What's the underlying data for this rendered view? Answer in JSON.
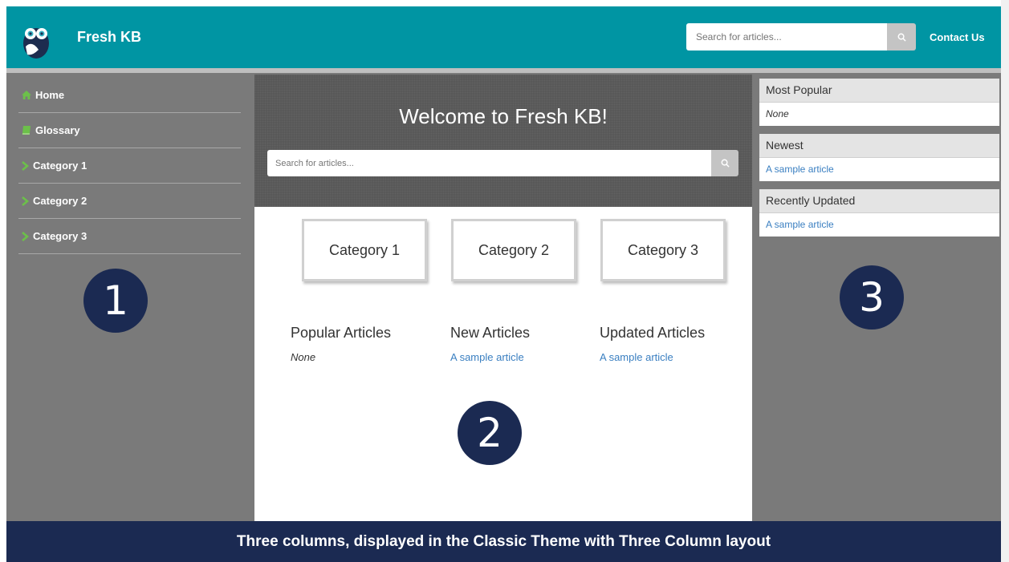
{
  "header": {
    "brand": "Fresh KB",
    "search_placeholder": "Search for articles...",
    "contact_label": "Contact Us"
  },
  "sidebar": {
    "items": [
      {
        "label": "Home",
        "icon": "home-icon"
      },
      {
        "label": "Glossary",
        "icon": "book-icon"
      },
      {
        "label": "Category 1",
        "icon": "chevron-right-icon"
      },
      {
        "label": "Category 2",
        "icon": "chevron-right-icon"
      },
      {
        "label": "Category 3",
        "icon": "chevron-right-icon"
      }
    ]
  },
  "hero": {
    "title": "Welcome to Fresh KB!",
    "search_placeholder": "Search for articles..."
  },
  "categories": [
    "Category 1",
    "Category 2",
    "Category 3"
  ],
  "articles": {
    "popular": {
      "title": "Popular Articles",
      "value": "None"
    },
    "new": {
      "title": "New Articles",
      "value": "A sample article"
    },
    "updated": {
      "title": "Updated Articles",
      "value": "A sample article"
    }
  },
  "right_panels": [
    {
      "title": "Most Popular",
      "value": "None"
    },
    {
      "title": "Newest",
      "value": "A sample article"
    },
    {
      "title": "Recently Updated",
      "value": "A sample article"
    }
  ],
  "markers": [
    "1",
    "2",
    "3"
  ],
  "caption": "Three columns, displayed in the Classic Theme with Three Column layout",
  "colors": {
    "header": "#0095a3",
    "sidebar": "#7a7a7a",
    "marker": "#1b2a52",
    "link": "#3a7fc1",
    "accent_icon": "#6cc04a"
  }
}
